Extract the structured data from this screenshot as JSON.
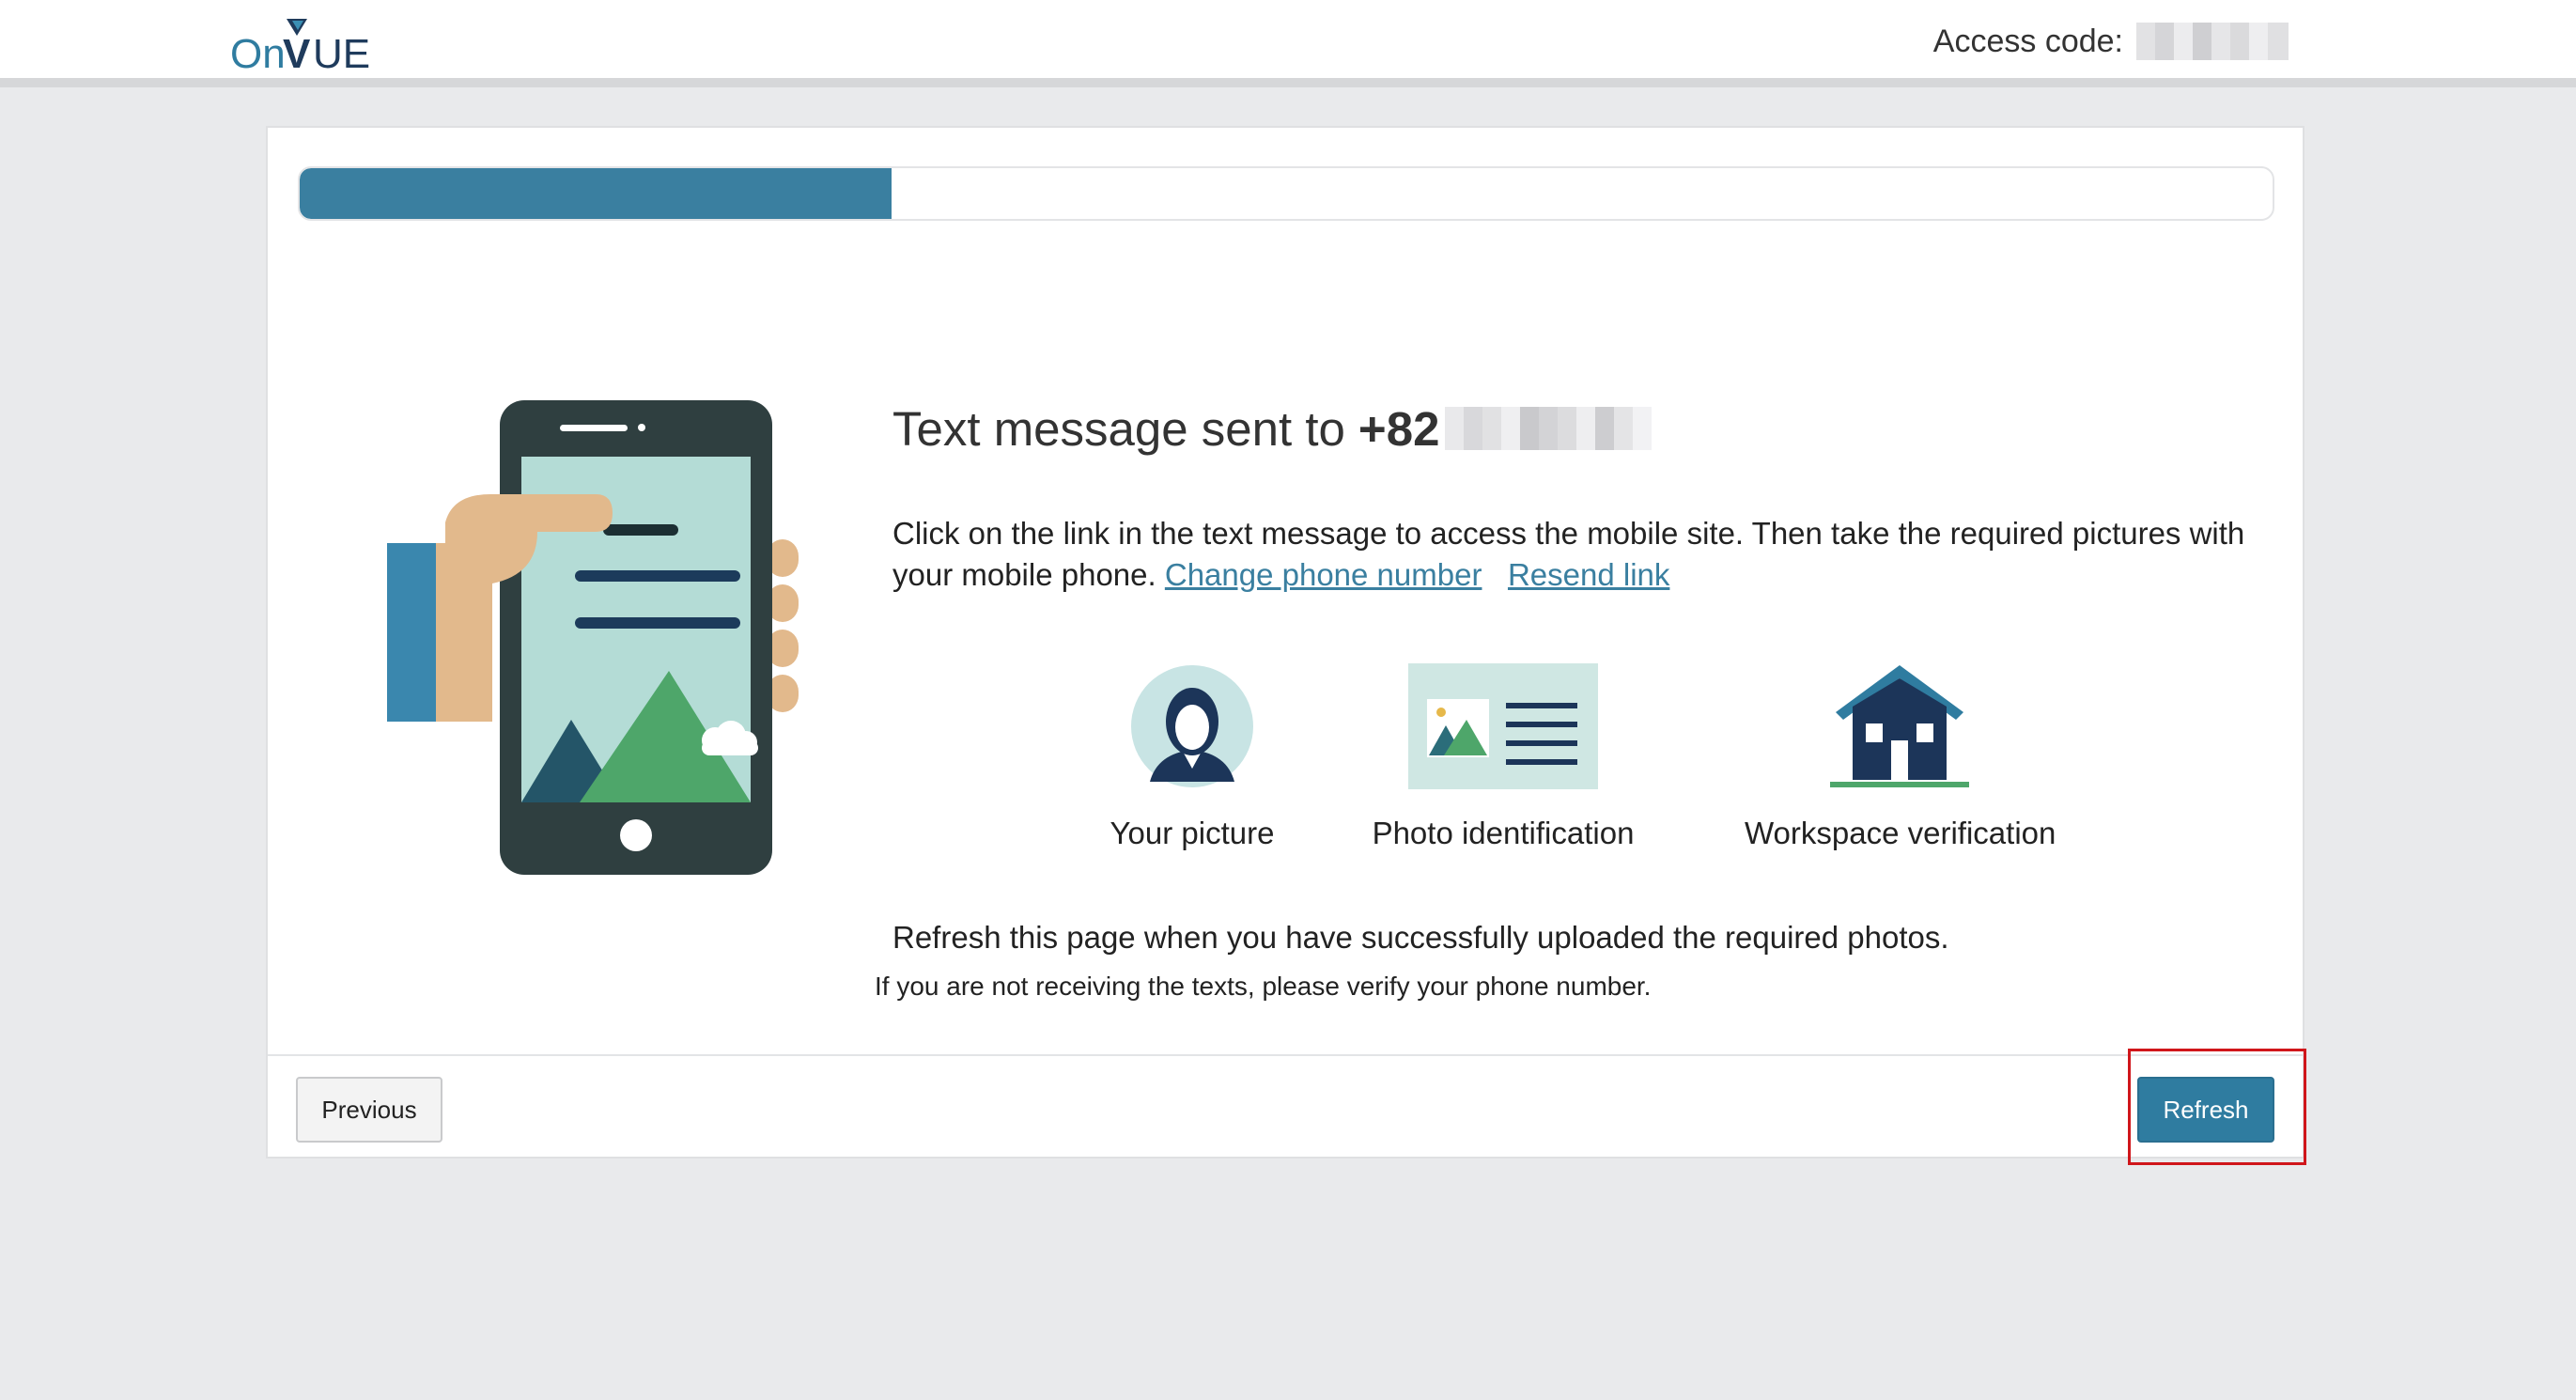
{
  "header": {
    "logo_alt": "OnVUE",
    "access_code_label": "Access code:"
  },
  "progress": {
    "value_percent": 30
  },
  "main": {
    "title_text": "Text message sent to",
    "phone_prefix": "+82",
    "description": "Click on the link in the text message to access the mobile site. Then take the required pictures with your mobile phone.",
    "change_phone_link": "Change phone number",
    "resend_link": "Resend link",
    "requirements": [
      {
        "label": "Your picture",
        "icon": "person-icon"
      },
      {
        "label": "Photo identification",
        "icon": "id-card-icon"
      },
      {
        "label": "Workspace verification",
        "icon": "house-icon"
      }
    ],
    "refresh_note": "Refresh this page when you have successfully uploaded the required photos.",
    "small_note": "If you are not receiving the texts, please verify your phone number."
  },
  "footer": {
    "previous_label": "Previous",
    "refresh_label": "Refresh"
  },
  "colors": {
    "accent": "#2f7ca0",
    "progress": "#3a7fa0",
    "highlight": "#d0161b",
    "background": "#e9eaec"
  }
}
